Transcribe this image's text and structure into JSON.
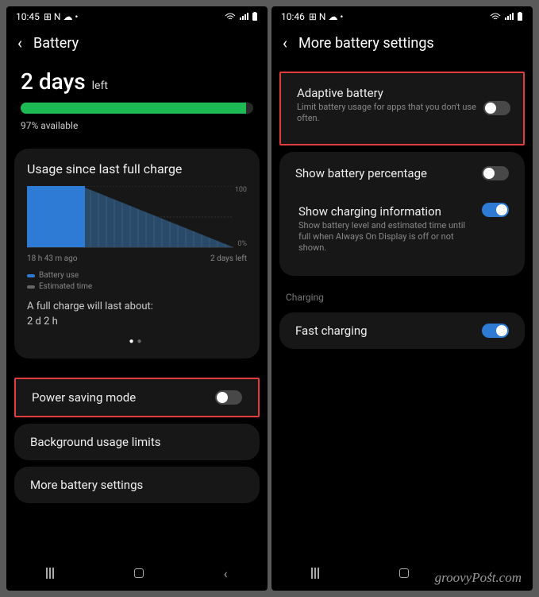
{
  "left": {
    "status": {
      "time": "10:45",
      "icons": "⊞ N ☁ •"
    },
    "header": {
      "title": "Battery"
    },
    "remaining": {
      "big": "2 days",
      "suffix": "left",
      "available": "97% available",
      "pct": 97
    },
    "usage": {
      "title": "Usage since last full charge",
      "y_top": "100",
      "y_bot": "0%",
      "x_left": "18 h 43 m ago",
      "x_right": "2 days left",
      "legend_use": "Battery use",
      "legend_est": "Estimated time",
      "est_label": "A full charge will last about:",
      "est_value": "2 d 2 h"
    },
    "rows": {
      "power_saving": "Power saving mode",
      "bg_limits": "Background usage limits",
      "more": "More battery settings"
    }
  },
  "right": {
    "status": {
      "time": "10:46",
      "icons": "⊞ N ☁ •"
    },
    "header": {
      "title": "More battery settings"
    },
    "adaptive": {
      "title": "Adaptive battery",
      "sub": "Limit battery usage for apps that you don't use often."
    },
    "show_pct": {
      "title": "Show battery percentage"
    },
    "charging_info": {
      "title": "Show charging information",
      "sub": "Show battery level and estimated time until full when Always On Display is off or not shown."
    },
    "section": "Charging",
    "fast": {
      "title": "Fast charging"
    }
  },
  "watermark": "groovyPost.com",
  "chart_data": {
    "type": "area",
    "title": "Usage since last full charge",
    "x_range": [
      "18 h 43 m ago",
      "2 days left"
    ],
    "y_range": [
      0,
      100
    ],
    "series": [
      {
        "name": "Battery use",
        "color": "#2e7bd6",
        "points": [
          [
            0,
            100
          ],
          [
            0.28,
            97
          ]
        ]
      },
      {
        "name": "Estimated time",
        "color": "#666",
        "points": [
          [
            0.28,
            97
          ],
          [
            1.0,
            0
          ]
        ]
      }
    ]
  }
}
